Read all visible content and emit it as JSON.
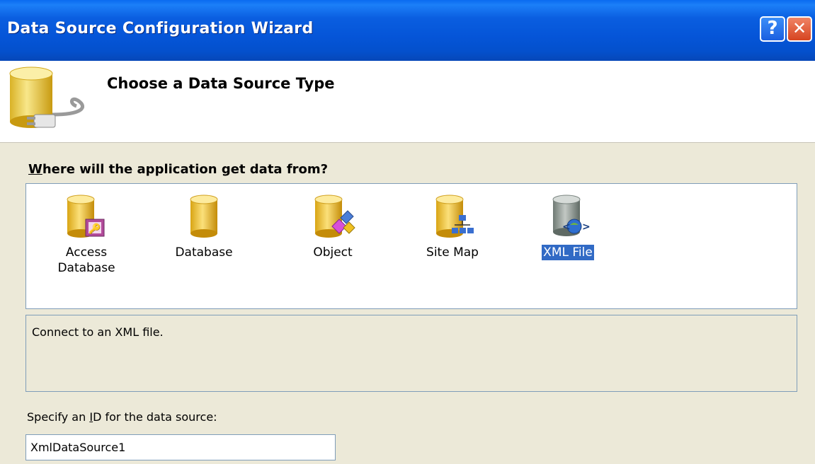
{
  "window": {
    "title": "Data Source Configuration Wizard",
    "help_glyph": "?",
    "close_glyph": "✕"
  },
  "header": {
    "title": "Choose a Data Source Type",
    "icon": "database-plug-icon"
  },
  "main": {
    "prompt_prefix": "W",
    "prompt_rest": "here will the application get data from?",
    "types": [
      {
        "label_line1": "Access",
        "label_line2": "Database",
        "icon": "access-database-icon",
        "selected": false
      },
      {
        "label_line1": "Database",
        "label_line2": "",
        "icon": "database-icon",
        "selected": false
      },
      {
        "label_line1": "Object",
        "label_line2": "",
        "icon": "object-icon",
        "selected": false
      },
      {
        "label_line1": "Site Map",
        "label_line2": "",
        "icon": "site-map-icon",
        "selected": false
      },
      {
        "label_line1": "XML File",
        "label_line2": "",
        "icon": "xml-file-icon",
        "selected": true
      }
    ],
    "description": "Connect to an XML file.",
    "id_label_prefix": "Specify an ",
    "id_label_accel": "I",
    "id_label_suffix": "D for the data source:",
    "id_value": "XmlDataSource1"
  },
  "colors": {
    "titlebar": "#0555d8",
    "selection": "#316ac5",
    "dialog_bg": "#ece9d8"
  }
}
